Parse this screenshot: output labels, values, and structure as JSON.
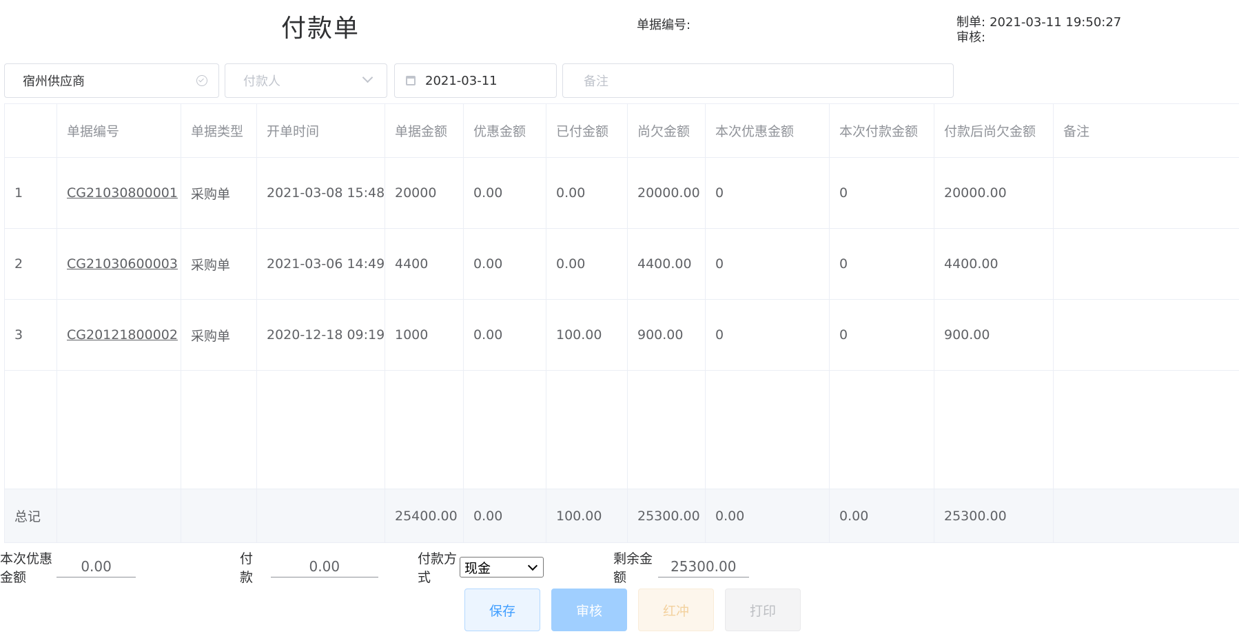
{
  "header": {
    "title": "付款单",
    "doc_no_label": "单据编号:",
    "maker_label": "制单:",
    "maker_time": "2021-03-11 19:50:27",
    "auditor_label": "审核:"
  },
  "filters": {
    "supplier": "宿州供应商",
    "payer_placeholder": "付款人",
    "date": "2021-03-11",
    "note_placeholder": "备注"
  },
  "table": {
    "columns": [
      "",
      "单据编号",
      "单据类型",
      "开单时间",
      "单据金额",
      "优惠金额",
      "已付金额",
      "尚欠金额",
      "本次优惠金额",
      "本次付款金额",
      "付款后尚欠金额",
      "备注"
    ],
    "rows": [
      [
        "1",
        "CG21030800001",
        "采购单",
        "2021-03-08 15:48",
        "20000",
        "0.00",
        "0.00",
        "20000.00",
        "0",
        "0",
        "20000.00",
        ""
      ],
      [
        "2",
        "CG21030600003",
        "采购单",
        "2021-03-06 14:49",
        "4400",
        "0.00",
        "0.00",
        "4400.00",
        "0",
        "0",
        "4400.00",
        ""
      ],
      [
        "3",
        "CG20121800002",
        "采购单",
        "2020-12-18 09:19",
        "1000",
        "0.00",
        "100.00",
        "900.00",
        "0",
        "0",
        "900.00",
        ""
      ]
    ],
    "footer": [
      "总记",
      "",
      "",
      "",
      "25400.00",
      "0.00",
      "100.00",
      "25300.00",
      "0.00",
      "0.00",
      "25300.00",
      ""
    ]
  },
  "summary": {
    "discount_label": "本次优惠金额",
    "discount_value": "0.00",
    "pay_label": "付款",
    "pay_value": "0.00",
    "paytype_label": "付款方式",
    "paytype_value": "现金",
    "remain_label": "剩余金额",
    "remain_value": "25300.00"
  },
  "buttons": {
    "save": "保存",
    "audit": "审核",
    "red": "红冲",
    "print": "打印"
  },
  "colors": {
    "primary": "#409eff",
    "primary_disabled": "#a0cfff",
    "warning_disabled": "#f3d19e",
    "border": "#dcdfe6"
  }
}
